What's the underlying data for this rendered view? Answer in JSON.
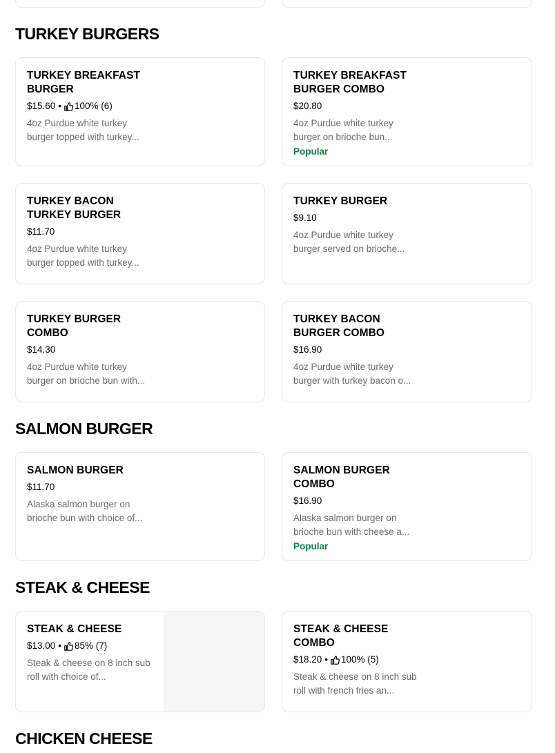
{
  "sections": [
    {
      "title": "TURKEY BURGERS",
      "items": [
        {
          "name": "TURKEY BREAKFAST BURGER",
          "price": "$15.60",
          "rating": "100% (6)",
          "description": "4oz Purdue white turkey burger topped with turkey...",
          "badge": ""
        },
        {
          "name": "TURKEY BREAKFAST BURGER COMBO",
          "price": "$20.80",
          "rating": "",
          "description": "4oz Purdue white turkey burger on brioche bun...",
          "badge": "Popular"
        },
        {
          "name": "TURKEY BACON TURKEY BURGER",
          "price": "$11.70",
          "rating": "",
          "description": "4oz Purdue white turkey burger topped with turkey...",
          "badge": ""
        },
        {
          "name": "TURKEY BURGER",
          "price": "$9.10",
          "rating": "",
          "description": "4oz Purdue white turkey burger served on brioche...",
          "badge": ""
        },
        {
          "name": "TURKEY BURGER COMBO",
          "price": "$14.30",
          "rating": "",
          "description": "4oz Purdue white turkey burger on brioche bun with...",
          "badge": ""
        },
        {
          "name": "TURKEY BACON BURGER COMBO",
          "price": "$16.90",
          "rating": "",
          "description": "4oz Purdue white turkey burger with turkey bacon o...",
          "badge": ""
        }
      ]
    },
    {
      "title": "SALMON BURGER",
      "items": [
        {
          "name": "SALMON BURGER",
          "price": "$11.70",
          "rating": "",
          "description": "Alaska salmon burger on brioche bun with choice of...",
          "badge": ""
        },
        {
          "name": "SALMON BURGER COMBO",
          "price": "$16.90",
          "rating": "",
          "description": "Alaska salmon burger on brioche bun with cheese a...",
          "badge": "Popular"
        }
      ]
    },
    {
      "title": "STEAK & CHEESE",
      "items": [
        {
          "name": "STEAK & CHEESE",
          "price": "$13.00",
          "rating": "85% (7)",
          "description": "Steak & cheese on 8 inch sub roll with choice of...",
          "badge": ""
        },
        {
          "name": "STEAK & CHEESE COMBO",
          "price": "$18.20",
          "rating": "100% (5)",
          "description": "Steak & cheese on 8 inch sub roll with french fries an...",
          "badge": ""
        }
      ]
    },
    {
      "title": "CHICKEN CHEESE",
      "items": []
    }
  ],
  "colors": {
    "popular": "#0e8345",
    "description": "#6b6b6b",
    "border": "#e8e8e8"
  },
  "icons": {
    "rating": "thumbs-up-icon"
  },
  "separator": "•"
}
